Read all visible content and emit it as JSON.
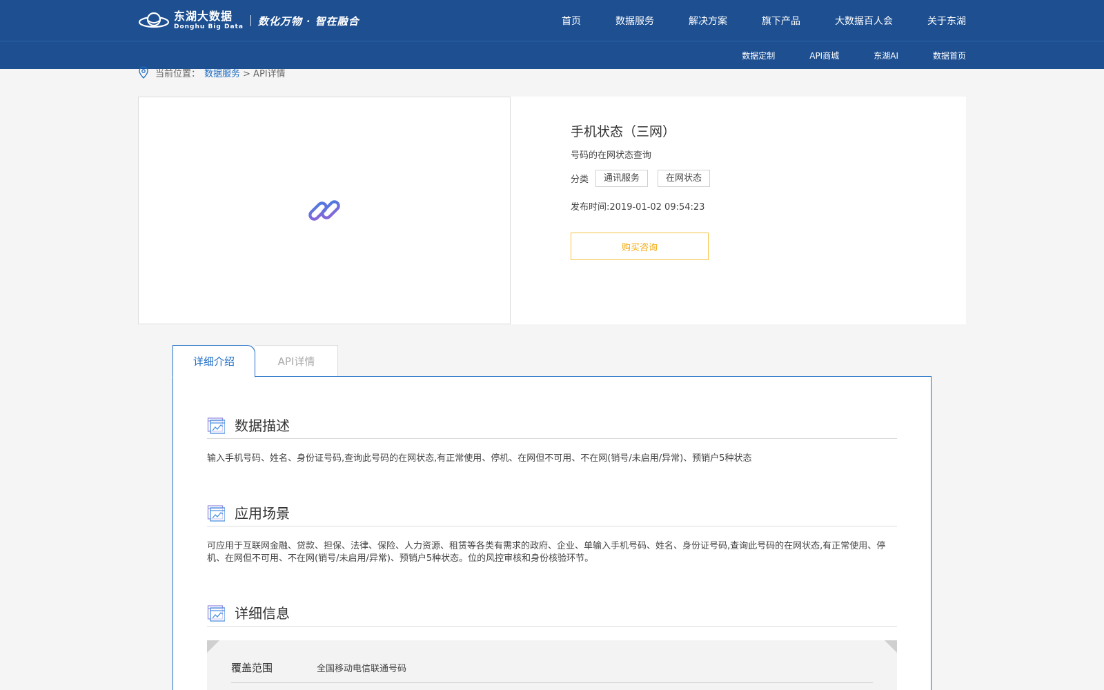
{
  "header": {
    "brand_cn": "东湖大数据",
    "brand_en": "Donghu Big Data",
    "slogan": "数化万物 · 智在融合",
    "nav": [
      "首页",
      "数据服务",
      "解决方案",
      "旗下产品",
      "大数据百人会",
      "关于东湖"
    ],
    "subnav": [
      "数据定制",
      "API商城",
      "东湖AI",
      "数据首页"
    ]
  },
  "breadcrumb": {
    "prefix": "当前位置：",
    "link": "数据服务",
    "current": "> API详情"
  },
  "product": {
    "title": "手机状态（三网）",
    "subtitle": "号码的在网状态查询",
    "category_label": "分类",
    "tags": [
      "通讯服务",
      "在网状态"
    ],
    "published": "发布时间:2019-01-02 09:54:23",
    "buy_label": "购买咨询",
    "image_icon": "chain-link-icon"
  },
  "tabs": [
    "详细介绍",
    "API详情"
  ],
  "sections": [
    {
      "heading": "数据描述",
      "text": "输入手机号码、姓名、身份证号码,查询此号码的在网状态,有正常使用、停机、在网但不可用、不在网(销号/未启用/异常)、预销户5种状态"
    },
    {
      "heading": "应用场景",
      "text": "可应用于互联网金融、贷款、担保、法律、保险、人力资源、租赁等各类有需求的政府、企业、单输入手机号码、姓名、身份证号码,查询此号码的在网状态,有正常使用、停机、在网但不可用、不在网(销号/未启用/异常)、预销户5种状态。位的风控审核和身份核验环节。"
    },
    {
      "heading": "详细信息",
      "text": ""
    }
  ],
  "details": [
    {
      "key": "覆盖范围",
      "value": "全国移动电信联通号码"
    }
  ],
  "colors": {
    "header_bg": "#1d4f91",
    "accent": "#1d6cc4",
    "buy_border": "#f5c342",
    "buy_text": "#f2a90b"
  }
}
